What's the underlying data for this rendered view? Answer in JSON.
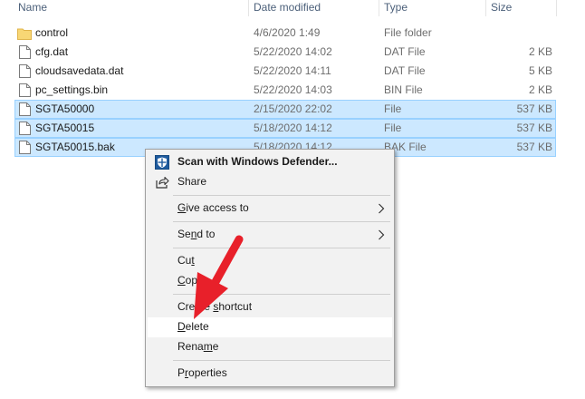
{
  "columns": {
    "name": "Name",
    "date": "Date modified",
    "type": "Type",
    "size": "Size"
  },
  "files": [
    {
      "name": "control",
      "date": "4/6/2020 1:49",
      "type": "File folder",
      "size": "",
      "kind": "folder",
      "selected": false
    },
    {
      "name": "cfg.dat",
      "date": "5/22/2020 14:02",
      "type": "DAT File",
      "size": "2 KB",
      "kind": "file",
      "selected": false
    },
    {
      "name": "cloudsavedata.dat",
      "date": "5/22/2020 14:11",
      "type": "DAT File",
      "size": "5 KB",
      "kind": "file",
      "selected": false
    },
    {
      "name": "pc_settings.bin",
      "date": "5/22/2020 14:03",
      "type": "BIN File",
      "size": "2 KB",
      "kind": "file",
      "selected": false
    },
    {
      "name": "SGTA50000",
      "date": "2/15/2020 22:02",
      "type": "File",
      "size": "537 KB",
      "kind": "file",
      "selected": true
    },
    {
      "name": "SGTA50015",
      "date": "5/18/2020 14:12",
      "type": "File",
      "size": "537 KB",
      "kind": "file",
      "selected": true
    },
    {
      "name": "SGTA50015.bak",
      "date": "5/18/2020 14:12",
      "type": "BAK File",
      "size": "537 KB",
      "kind": "file",
      "selected": true
    }
  ],
  "context_menu": {
    "scan": "Scan with Windows Defender...",
    "share": "Share",
    "give_access_pre": "",
    "give_access_u": "G",
    "give_access_post": "ive access to",
    "send_to_pre": "Se",
    "send_to_u": "n",
    "send_to_post": "d to",
    "cut_pre": "Cu",
    "cut_u": "t",
    "cut_post": "",
    "copy_pre": "",
    "copy_u": "C",
    "copy_post": "opy",
    "create_shortcut_pre": "Create ",
    "create_shortcut_u": "s",
    "create_shortcut_post": "hortcut",
    "delete_pre": "",
    "delete_u": "D",
    "delete_post": "elete",
    "rename_pre": "Rena",
    "rename_u": "m",
    "rename_post": "e",
    "properties_pre": "P",
    "properties_u": "r",
    "properties_post": "operties"
  },
  "colors": {
    "selection": "#cce8ff",
    "selection_border": "#99d1ff",
    "menu_bg": "#f2f2f2",
    "annotation_arrow": "#e8202a",
    "folder": "#f8d775"
  },
  "icons": {
    "folder": "folder-icon",
    "file": "file-icon",
    "defender": "windows-defender-icon",
    "share": "share-icon",
    "submenu": "chevron-right-icon"
  }
}
